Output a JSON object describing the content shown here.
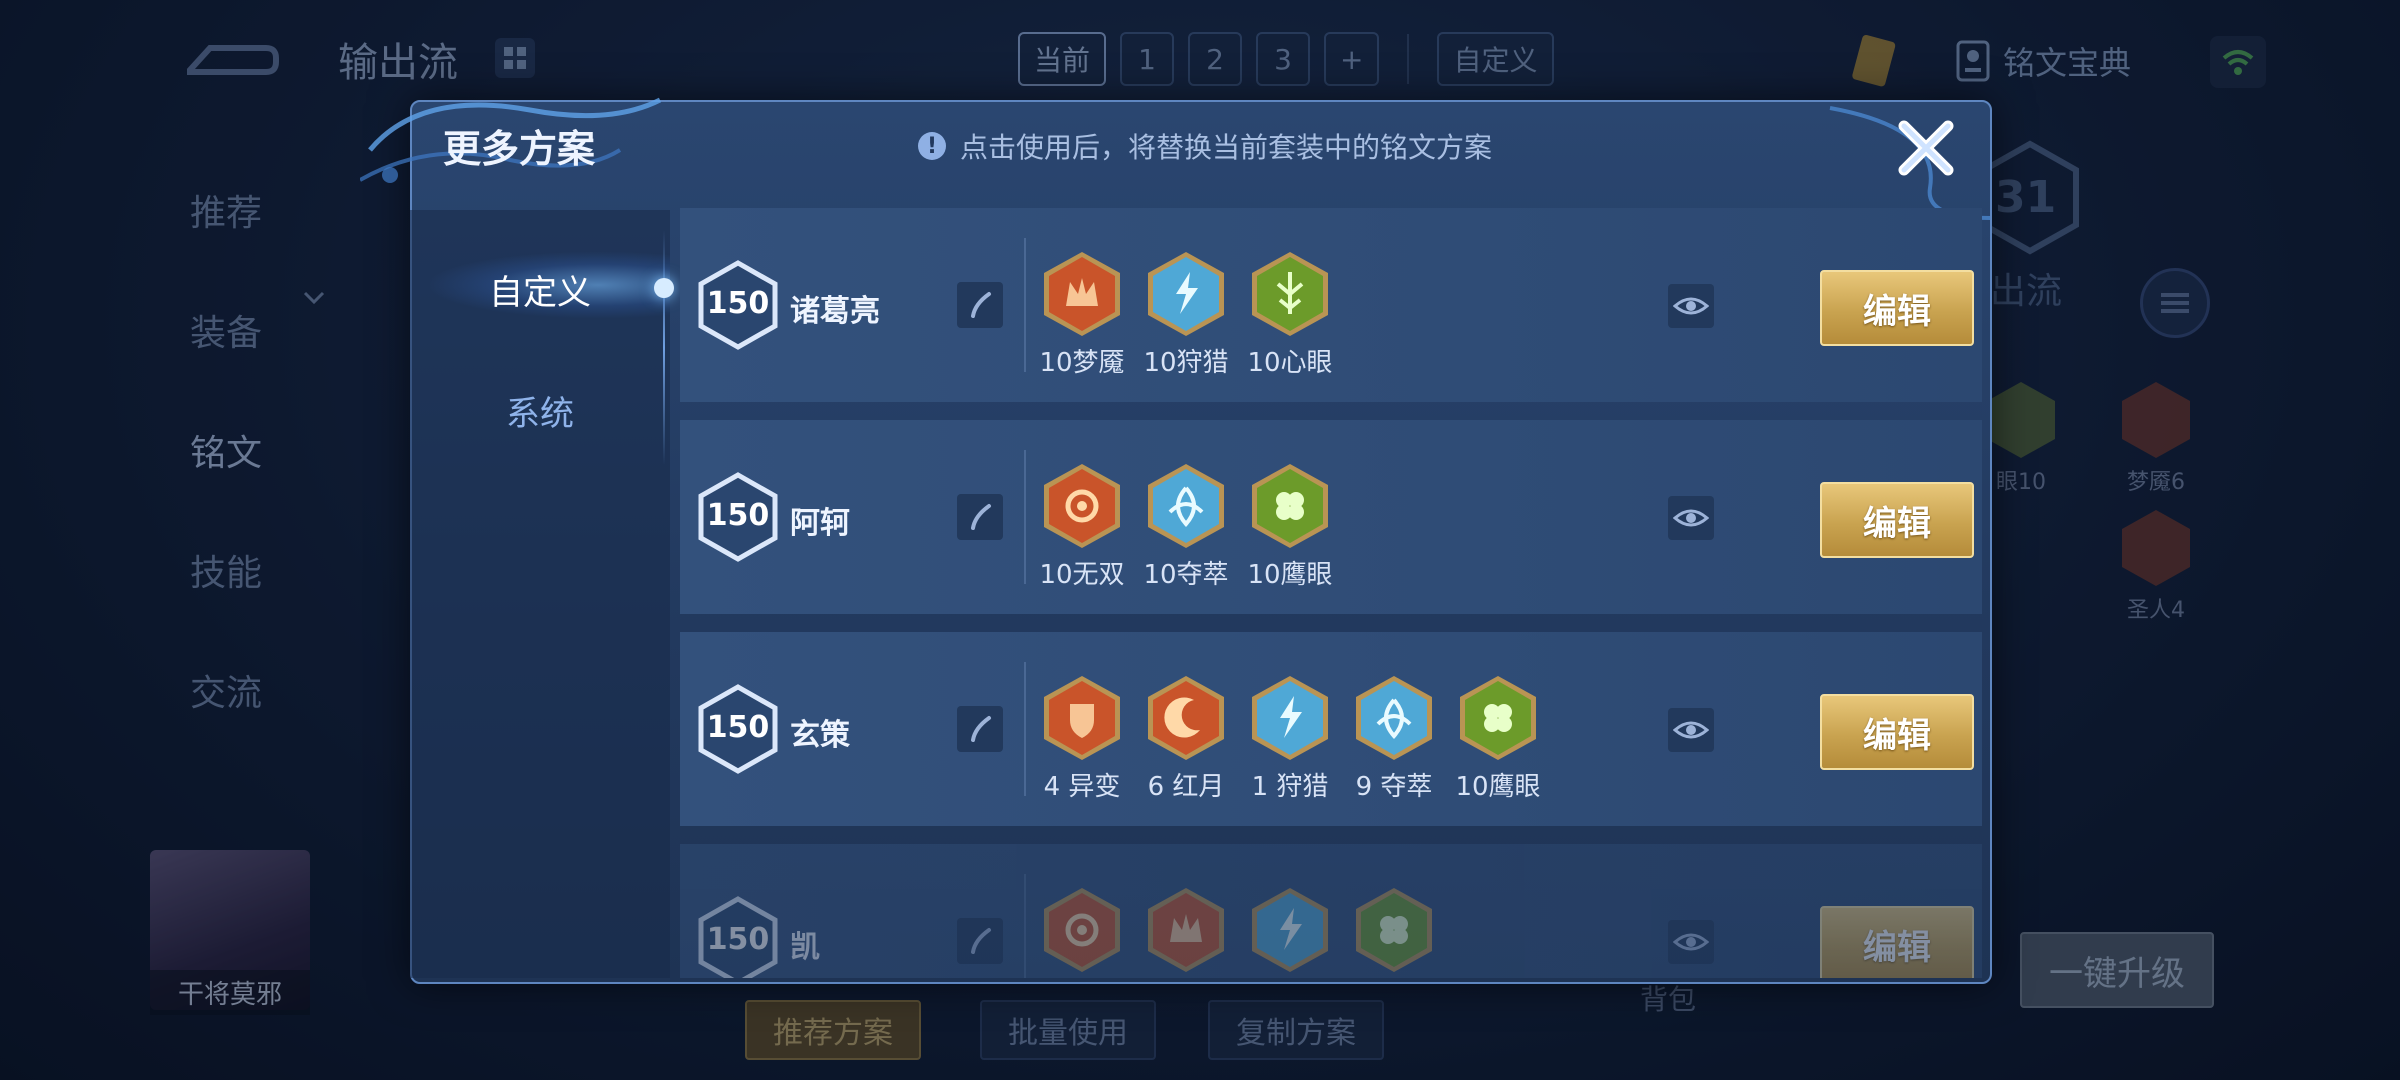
{
  "background": {
    "title": "输出流",
    "tabs": [
      "当前",
      "1",
      "2",
      "3",
      "+"
    ],
    "custom_tab": "自定义",
    "codex": "铭文宝典",
    "nav": [
      "推荐",
      "装备",
      "铭文",
      "技能",
      "交流"
    ],
    "hero_name": "干将莫邪",
    "bottom_buttons": [
      "推荐方案",
      "批量使用",
      "复制方案"
    ],
    "backpack": "背包",
    "upgrade": "一键升级",
    "level": "31",
    "right_label": "出流",
    "right_runes": [
      {
        "label": "眼10",
        "color": "#7a8f3a"
      },
      {
        "label": "梦魇6",
        "color": "#a2472a"
      },
      {
        "label": "圣人4",
        "color": "#a2472a"
      }
    ]
  },
  "modal": {
    "title": "更多方案",
    "notice": "点击使用后，将替换当前套装中的铭文方案",
    "notice_icon": "exclamation-icon",
    "tabs": [
      "自定义",
      "系统"
    ],
    "edit_label": "编辑",
    "plans": [
      {
        "level": "150",
        "hero": "诸葛亮",
        "runes": [
          {
            "label": "10梦魇",
            "color": "#c9542a",
            "icon": "crown"
          },
          {
            "label": "10狩猎",
            "color": "#4fa8d6",
            "icon": "bolt"
          },
          {
            "label": "10心眼",
            "color": "#6c9b2a",
            "icon": "leaf"
          }
        ]
      },
      {
        "level": "150",
        "hero": "阿轲",
        "runes": [
          {
            "label": "10无双",
            "color": "#c9542a",
            "icon": "swirl"
          },
          {
            "label": "10夺萃",
            "color": "#4fa8d6",
            "icon": "knot"
          },
          {
            "label": "10鹰眼",
            "color": "#6c9b2a",
            "icon": "clover"
          }
        ]
      },
      {
        "level": "150",
        "hero": "玄策",
        "runes": [
          {
            "label": "4 异变",
            "color": "#c9542a",
            "icon": "shield"
          },
          {
            "label": "6 红月",
            "color": "#c9542a",
            "icon": "moon"
          },
          {
            "label": "1 狩猎",
            "color": "#4fa8d6",
            "icon": "bolt"
          },
          {
            "label": "9 夺萃",
            "color": "#4fa8d6",
            "icon": "knot"
          },
          {
            "label": "10鹰眼",
            "color": "#6c9b2a",
            "icon": "clover"
          }
        ]
      },
      {
        "level": "150",
        "hero": "凯",
        "runes": [
          {
            "label": "",
            "color": "#c9542a",
            "icon": "swirl"
          },
          {
            "label": "",
            "color": "#c9542a",
            "icon": "crown"
          },
          {
            "label": "",
            "color": "#4fa8d6",
            "icon": "bolt"
          },
          {
            "label": "",
            "color": "#6c9b2a",
            "icon": "clover"
          }
        ]
      }
    ]
  }
}
